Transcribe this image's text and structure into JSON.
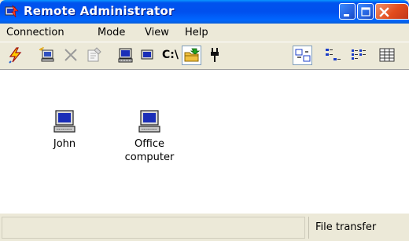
{
  "window": {
    "title": "Remote Administrator"
  },
  "menu": {
    "items": [
      {
        "label": "Connection"
      },
      {
        "label": "Mode"
      },
      {
        "label": "View"
      },
      {
        "label": "Help"
      }
    ]
  },
  "toolbar": {
    "buttons": [
      {
        "icon": "connect-icon"
      },
      {
        "icon": "add-connection-icon"
      },
      {
        "icon": "delete-icon"
      },
      {
        "icon": "properties-icon"
      },
      {
        "icon": "full-control-icon"
      },
      {
        "icon": "view-only-icon"
      },
      {
        "icon": "telnet-icon",
        "label": "C:\\"
      },
      {
        "icon": "file-transfer-icon",
        "pressed": true
      },
      {
        "icon": "shutdown-icon"
      },
      {
        "icon": "large-icons-icon",
        "pressed": true
      },
      {
        "icon": "small-icons-icon"
      },
      {
        "icon": "list-icon"
      },
      {
        "icon": "details-icon"
      }
    ]
  },
  "computers": [
    {
      "name": "John"
    },
    {
      "name": "Office computer",
      "line1": "Office",
      "line2": "computer"
    }
  ],
  "status": {
    "mode": "File transfer"
  },
  "colors": {
    "titlebar": "#0053ee",
    "close_button": "#e24c1c",
    "chrome": "#ece9d8"
  }
}
